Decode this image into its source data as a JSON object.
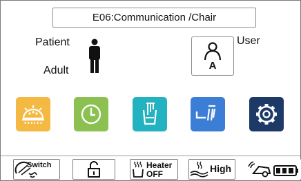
{
  "status": {
    "message": "E06:Communication /Chair"
  },
  "patient": {
    "label": "Patient",
    "type": "Adult"
  },
  "user": {
    "label": "User",
    "mode": "A"
  },
  "tiles": [
    {
      "name": "lamp",
      "icon": "lamp-icon",
      "color": "#f4b942"
    },
    {
      "name": "timer",
      "icon": "clock-icon",
      "color": "#8cc152"
    },
    {
      "name": "cup-fill",
      "icon": "cup-fill-icon",
      "color": "#23b2bf"
    },
    {
      "name": "chair-position",
      "icon": "chair-position-icon",
      "color": "#3c7dd6"
    },
    {
      "name": "settings",
      "icon": "gear-icon",
      "color": "#1d3a66"
    }
  ],
  "toolbar": {
    "switch_label": "Switch",
    "heater_label": "Heater",
    "heater_state": "OFF",
    "water_level": "High"
  }
}
